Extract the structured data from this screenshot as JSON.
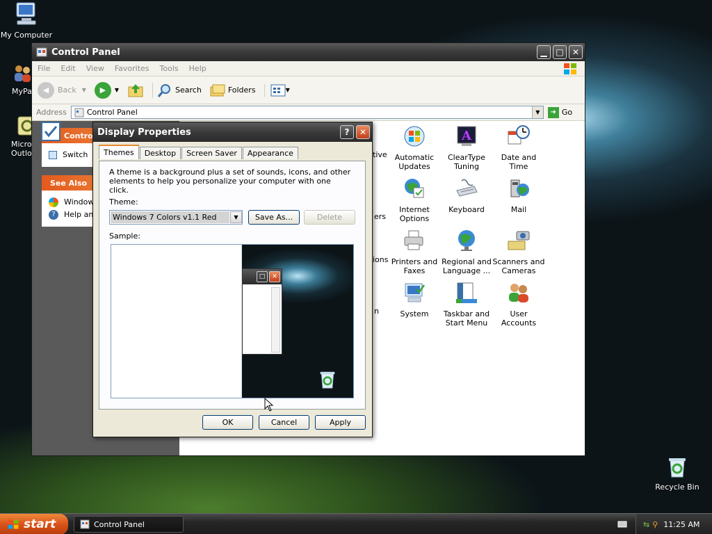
{
  "desktop": {
    "icons": [
      {
        "label": "My Computer"
      },
      {
        "label": "MyPa"
      },
      {
        "label": "Micros\nOutlo"
      },
      {
        "label": "Recycle Bin"
      }
    ]
  },
  "control_panel": {
    "title": "Control Panel",
    "menu": [
      "File",
      "Edit",
      "View",
      "Favorites",
      "Tools",
      "Help"
    ],
    "toolbar": {
      "back": "Back",
      "search": "Search",
      "folders": "Folders"
    },
    "address_label": "Address",
    "address_value": "Control Panel",
    "go_label": "Go",
    "sidebar": {
      "panel1_title": "Contro",
      "panel1_item": "Switch",
      "panel2_title": "See Also",
      "panel2_items": [
        "Window",
        "Help an"
      ]
    },
    "partial_labels": [
      "tive",
      "ers",
      "ions",
      "n"
    ],
    "items": [
      {
        "label": "Automatic Updates",
        "icon": "windows-update-icon"
      },
      {
        "label": "ClearType Tuning",
        "icon": "cleartype-icon"
      },
      {
        "label": "Date and Time",
        "icon": "date-time-icon"
      },
      {
        "label": "Internet Options",
        "icon": "internet-options-icon"
      },
      {
        "label": "Keyboard",
        "icon": "keyboard-icon"
      },
      {
        "label": "Mail",
        "icon": "mail-icon"
      },
      {
        "label": "Printers and Faxes",
        "icon": "printer-icon"
      },
      {
        "label": "Regional and Language ...",
        "icon": "globe-icon"
      },
      {
        "label": "Scanners and Cameras",
        "icon": "scanner-icon"
      },
      {
        "label": "System",
        "icon": "system-icon"
      },
      {
        "label": "Taskbar and Start Menu",
        "icon": "taskbar-icon"
      },
      {
        "label": "User Accounts",
        "icon": "users-icon"
      }
    ]
  },
  "display_properties": {
    "title": "Display Properties",
    "tabs": [
      "Themes",
      "Desktop",
      "Screen Saver",
      "Appearance"
    ],
    "description": "A theme is a background plus a set of sounds, icons, and other elements to help you personalize your computer with one click.",
    "theme_label": "Theme:",
    "theme_value": "Windows 7 Colors v1.1 Red",
    "save_as": "Save As...",
    "delete": "Delete",
    "sample_label": "Sample:",
    "ok": "OK",
    "cancel": "Cancel",
    "apply": "Apply"
  },
  "taskbar": {
    "start": "start",
    "task": "Control Panel",
    "clock": "11:25 AM"
  }
}
